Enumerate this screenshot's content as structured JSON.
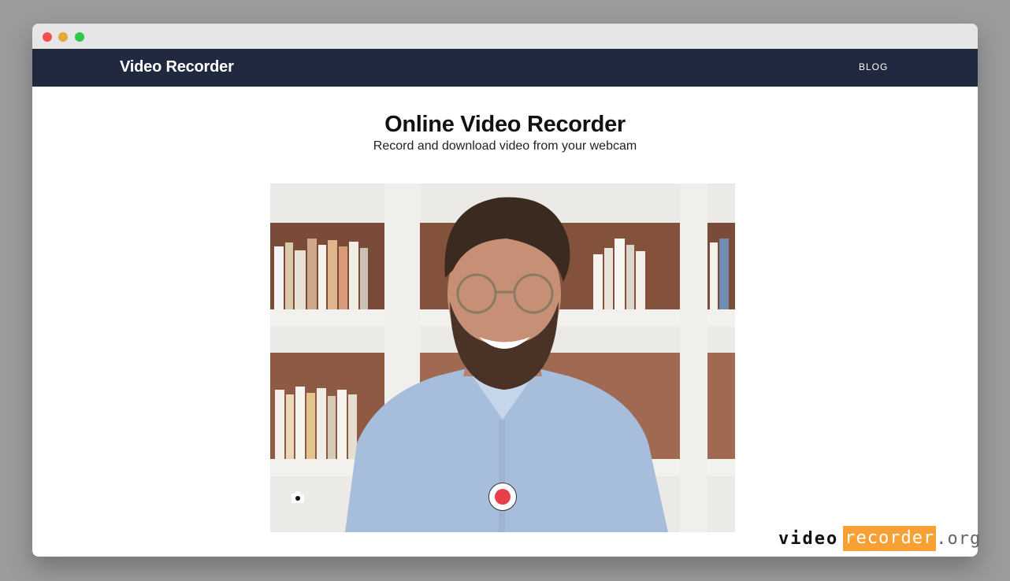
{
  "app": {
    "brand": "Video Recorder",
    "nav": {
      "blog": "BLOG"
    }
  },
  "hero": {
    "title": "Online Video Recorder",
    "subtitle": "Record and download video from your webcam"
  },
  "player": {
    "record_icon": "record-icon",
    "switch_camera_icon": "camera-icon"
  },
  "watermark": {
    "part1": "video",
    "part2": "recorder",
    "part3": ".org"
  },
  "colors": {
    "navbar": "#20293f",
    "record": "#e8404a",
    "accent": "#f7a134"
  }
}
